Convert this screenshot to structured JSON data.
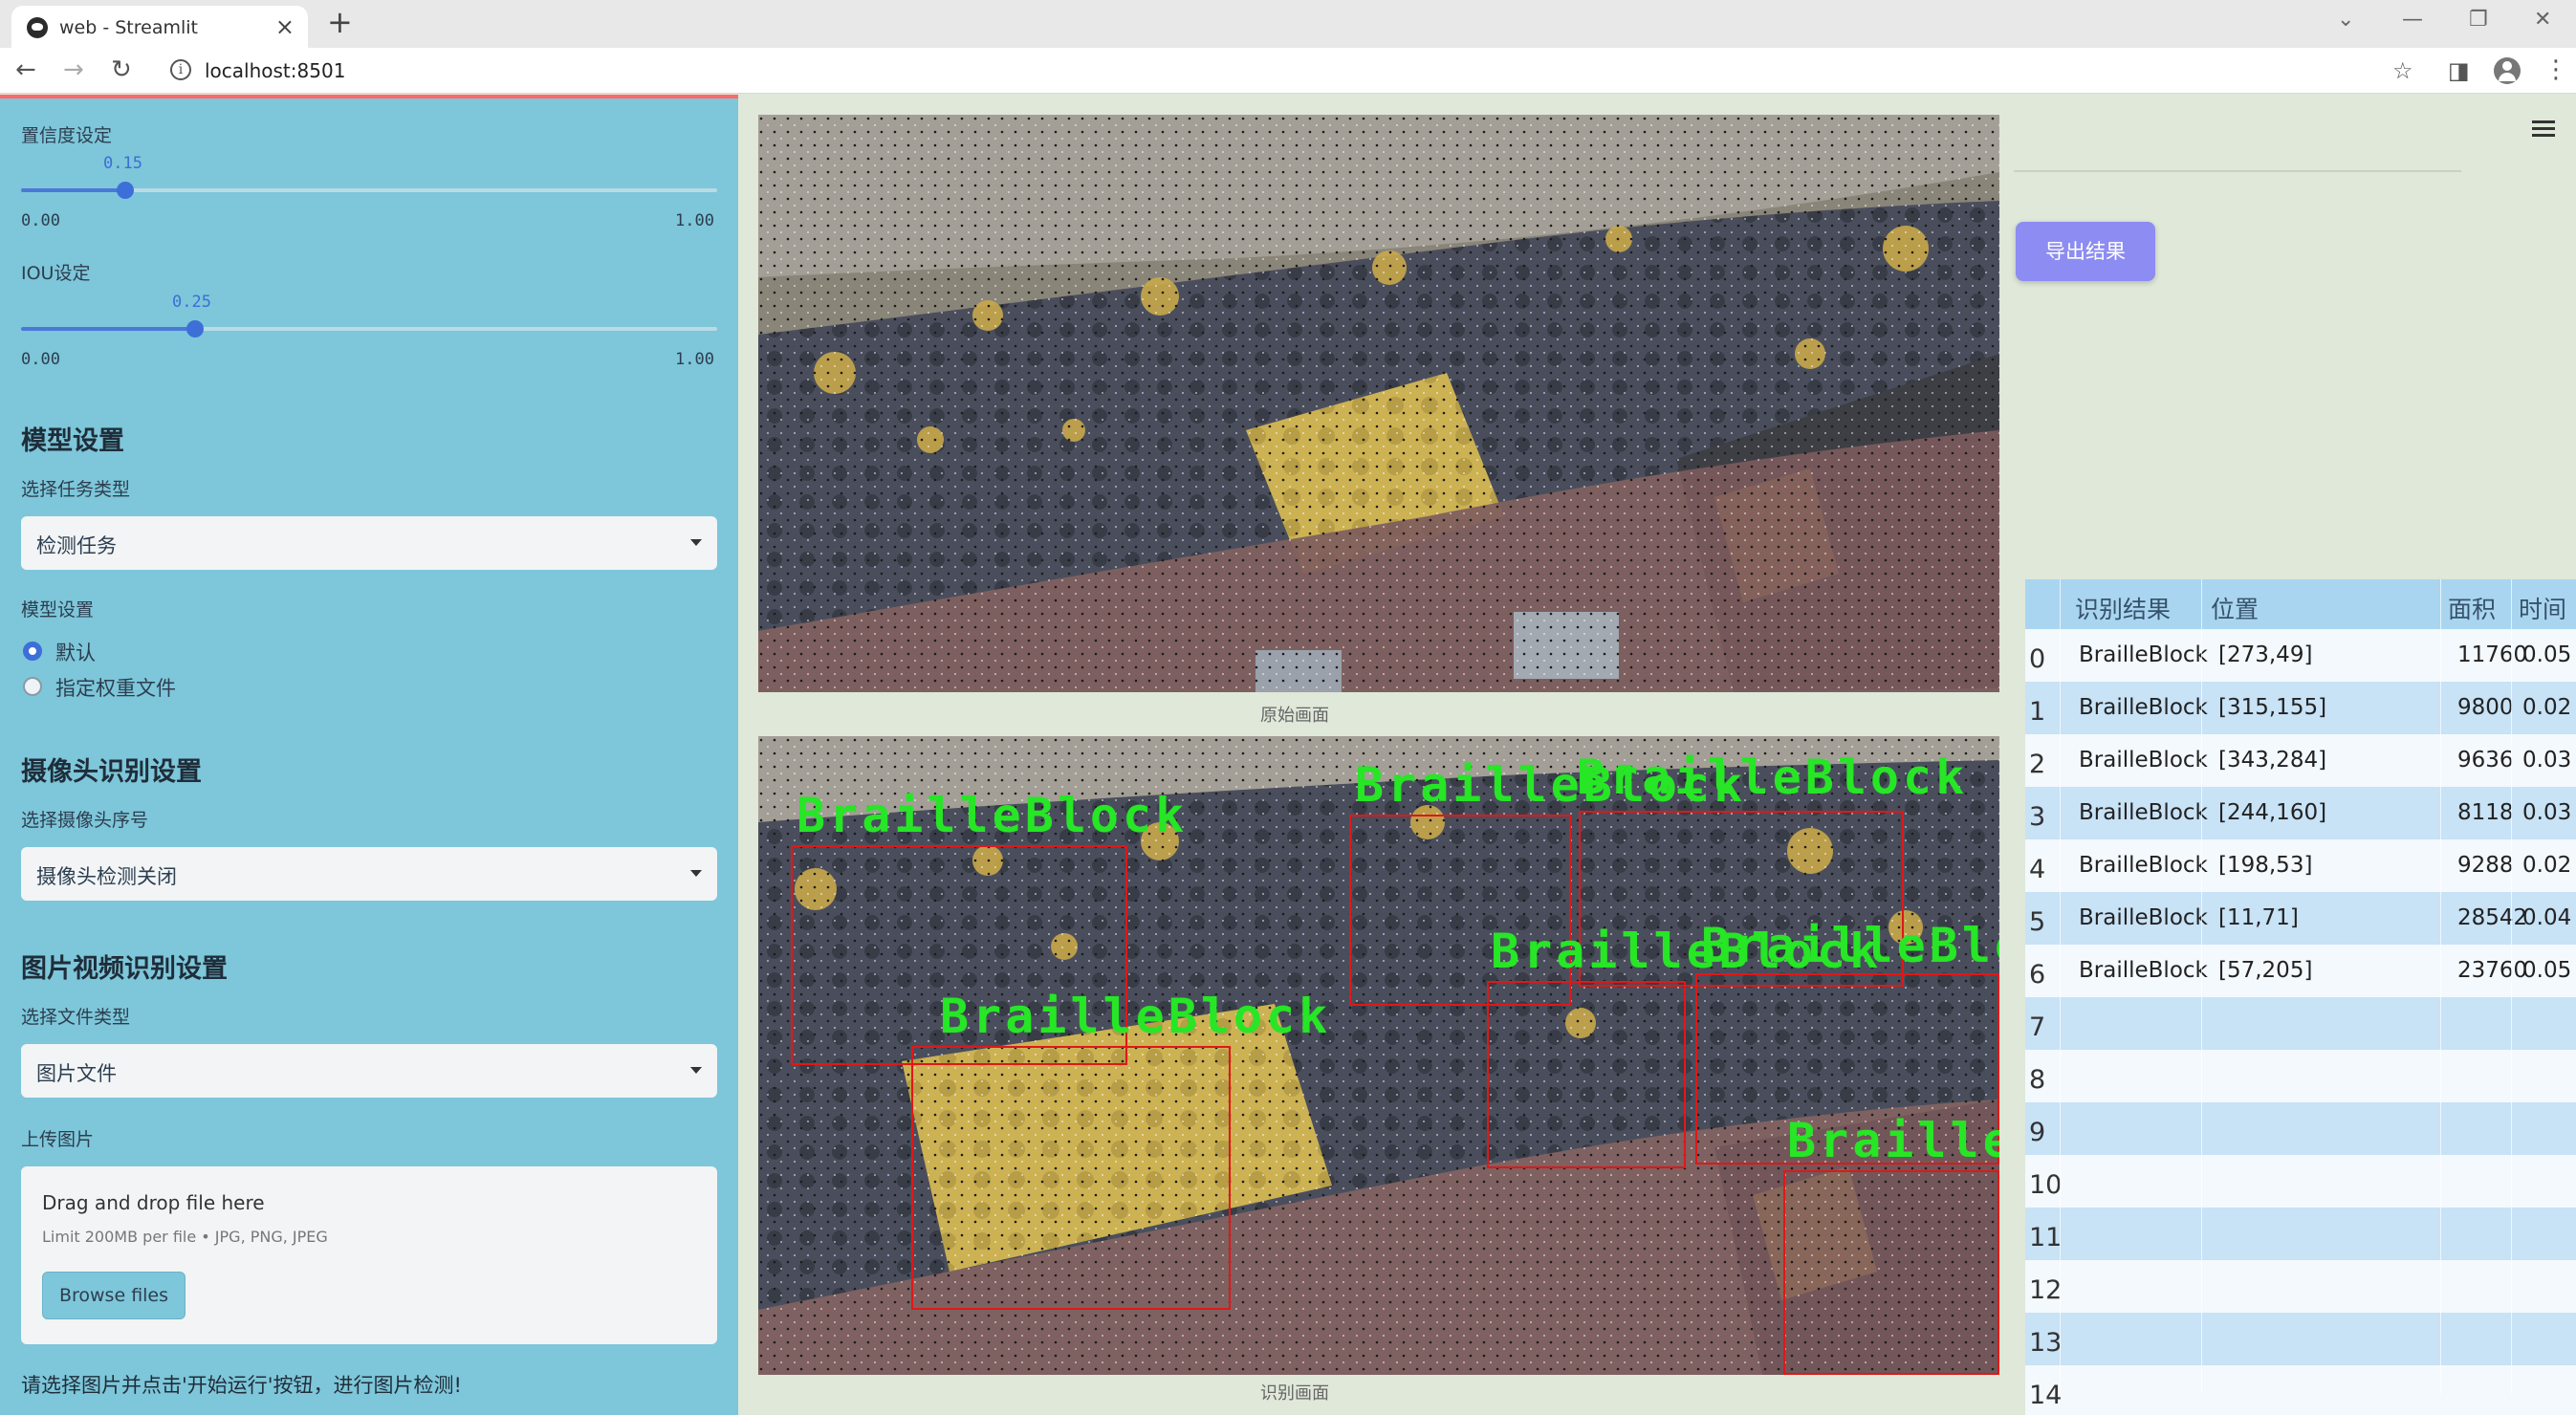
{
  "browser": {
    "tab_title": "web - Streamlit",
    "url": "localhost:8501"
  },
  "sidebar": {
    "confidence": {
      "label": "置信度设定",
      "value": "0.15",
      "min": "0.00",
      "max": "1.00",
      "fraction": 0.15
    },
    "iou": {
      "label": "IOU设定",
      "value": "0.25",
      "min": "0.00",
      "max": "1.00",
      "fraction": 0.25
    },
    "model_section": {
      "title": "模型设置",
      "task_label": "选择任务类型",
      "task_value": "检测任务",
      "model_label": "模型设置",
      "options": [
        "默认",
        "指定权重文件"
      ],
      "selected": "默认"
    },
    "camera_section": {
      "title": "摄像头识别设置",
      "camera_label": "选择摄像头序号",
      "camera_value": "摄像头检测关闭"
    },
    "media_section": {
      "title": "图片视频识别设置",
      "file_type_label": "选择文件类型",
      "file_type_value": "图片文件",
      "upload_label": "上传图片",
      "drop_text": "Drag and drop file here",
      "limit_text": "Limit 200MB per file • JPG, PNG, JPEG",
      "browse_label": "Browse files"
    },
    "hint": "请选择图片并点击'开始运行'按钮，进行图片检测!"
  },
  "main": {
    "original_caption": "原始画面",
    "result_caption": "识别画面",
    "detection_label": "BrailleBlock"
  },
  "right": {
    "export_label": "导出结果",
    "table": {
      "headers": [
        "识别结果",
        "位置",
        "面积",
        "时间"
      ],
      "rows": [
        {
          "idx": "0",
          "cls": "BrailleBlock",
          "pos": "[273,49]",
          "area": "11760",
          "time": "0.05"
        },
        {
          "idx": "1",
          "cls": "BrailleBlock",
          "pos": "[315,155]",
          "area": "9800",
          "time": "0.02"
        },
        {
          "idx": "2",
          "cls": "BrailleBlock",
          "pos": "[343,284]",
          "area": "9636",
          "time": "0.03"
        },
        {
          "idx": "3",
          "cls": "BrailleBlock",
          "pos": "[244,160]",
          "area": "8118",
          "time": "0.03"
        },
        {
          "idx": "4",
          "cls": "BrailleBlock",
          "pos": "[198,53]",
          "area": "9288",
          "time": "0.02"
        },
        {
          "idx": "5",
          "cls": "BrailleBlock",
          "pos": "[11,71]",
          "area": "28542",
          "time": "0.04"
        },
        {
          "idx": "6",
          "cls": "BrailleBlock",
          "pos": "[57,205]",
          "area": "23760",
          "time": "0.05"
        },
        {
          "idx": "7",
          "cls": "",
          "pos": "",
          "area": "",
          "time": ""
        },
        {
          "idx": "8",
          "cls": "",
          "pos": "",
          "area": "",
          "time": ""
        },
        {
          "idx": "9",
          "cls": "",
          "pos": "",
          "area": "",
          "time": ""
        },
        {
          "idx": "10",
          "cls": "",
          "pos": "",
          "area": "",
          "time": ""
        },
        {
          "idx": "11",
          "cls": "",
          "pos": "",
          "area": "",
          "time": ""
        },
        {
          "idx": "12",
          "cls": "",
          "pos": "",
          "area": "",
          "time": ""
        },
        {
          "idx": "13",
          "cls": "",
          "pos": "",
          "area": "",
          "time": ""
        },
        {
          "idx": "14",
          "cls": "",
          "pos": "",
          "area": "",
          "time": ""
        }
      ]
    }
  },
  "colors": {
    "sidebar_bg": "#7ec6d9",
    "accent": "#3d6fd8",
    "top_stripe": "#ff6b6b",
    "export_button": "#8d8cf2",
    "detection_box": "#e01818",
    "detection_text": "#26e626"
  }
}
